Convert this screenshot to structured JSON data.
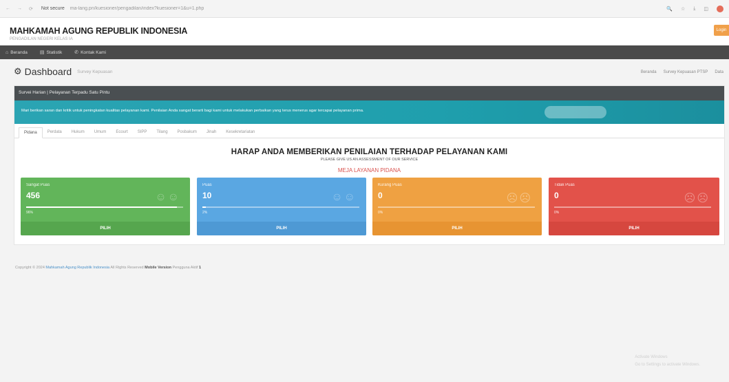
{
  "browser": {
    "url_label": "Not secure",
    "url": "ma-lang.pn/kuesioner/pengadilan/index?kuesioner=1&u=1.php",
    "nav": [
      "←",
      "→",
      "⟳"
    ],
    "tools": [
      "🔍",
      "☆",
      "⤓",
      "◫"
    ]
  },
  "site": {
    "title": "MAHKAMAH AGUNG REPUBLIK INDONESIA",
    "subtitle": "PENGADILAN NEGERI KELAS IA",
    "login_label": "Login"
  },
  "navbar": {
    "items": [
      {
        "icon": "home-icon",
        "glyph": "⌂",
        "label": "Beranda"
      },
      {
        "icon": "chart-icon",
        "glyph": "▤",
        "label": "Statistik"
      },
      {
        "icon": "phone-icon",
        "glyph": "✆",
        "label": "Kontak Kami"
      }
    ]
  },
  "dashboard": {
    "title": "Dashboard",
    "subtitle": "Survey Kepuasan",
    "crumbs": [
      "Beranda",
      "Survey Kepuasan PTSP",
      "Data"
    ]
  },
  "panel": {
    "header": "Survei Harian | Pelayanan Terpadu Satu Pintu",
    "banner": "Mari berikan saran dan kritik untuk peningkatan kualitas pelayanan kami. Penilaian Anda sangat berarti bagi kami untuk melakukan perbaikan yang terus menerus agar tercapai pelayanan prima.",
    "tabs": [
      "Pidana",
      "Perdata",
      "Hukum",
      "Umum",
      "Ecourt",
      "SIPP",
      "Tilang",
      "Posbakum",
      "Jinah",
      "Kesekretariatan"
    ],
    "active_tab": "Pidana",
    "headline": "HARAP ANDA MEMBERIKAN PENILAIAN TERHADAP PELAYANAN KAMI",
    "subline": "PLEASE GIVE US AN ASSESSMENT OF OUR SERVICE",
    "desk": "MEJA LAYANAN PIDANA"
  },
  "ratings": [
    {
      "label": "Sangat Puas",
      "count": "456",
      "progress": 0.96,
      "pct": "96%",
      "button": "PILIH"
    },
    {
      "label": "Puas",
      "count": "10",
      "progress": 0.02,
      "pct": "2%",
      "button": "PILIH"
    },
    {
      "label": "Kurang Puas",
      "count": "0",
      "progress": 0.0,
      "pct": "0%",
      "button": "PILIH"
    },
    {
      "label": "Tidak Puas",
      "count": "0",
      "progress": 0.0,
      "pct": "0%",
      "button": "PILIH"
    }
  ],
  "footer": {
    "prefix": "Copyright © 2024",
    "link": "Mahkamah Agung Republik Indonesia",
    "middle": "All Rights Reserved",
    "brand": "Mobile Version",
    "counter": "Pengguna Aktif",
    "count": "1"
  },
  "watermark": {
    "line1": "Activate Windows",
    "line2": "Go to Settings to activate Windows."
  },
  "colors": {
    "green": "#62b55a",
    "blue": "#5aa7e2",
    "orange": "#efa142",
    "red": "#e2524a",
    "banner": "#2ba4b3",
    "navbar": "#4a4a4a"
  }
}
